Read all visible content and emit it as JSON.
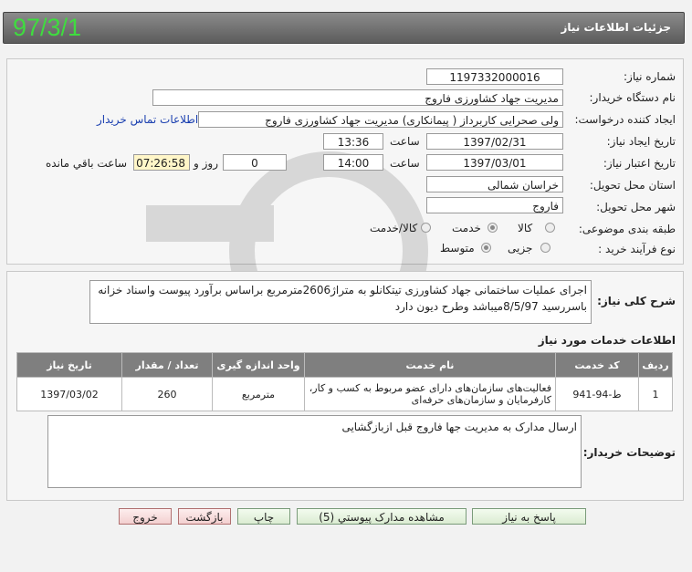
{
  "header": {
    "title": "جزئیات اطلاعات نیاز",
    "date_badge": "97/3/1"
  },
  "form": {
    "need_number": {
      "label": "شماره نیاز:",
      "value": "1197332000016"
    },
    "buyer_org": {
      "label": "نام دستگاه خریدار:",
      "value": "مدیریت جهاد کشاورزی فاروج"
    },
    "requester": {
      "label": "ایجاد کننده درخواست:",
      "value": "ولی صحرایی کاربرداز ( پیمانکاری) مدیریت جهاد کشاورزی فاروج",
      "contact_link": "اطلاعات تماس خریدار"
    },
    "created": {
      "label": "تاریخ ایجاد نیاز:",
      "date": "1397/02/31",
      "time_label": "ساعت",
      "time": "13:36"
    },
    "validity": {
      "label": "تاریخ اعتبار نیاز:",
      "date": "1397/03/01",
      "time_label": "ساعت",
      "time": "14:00",
      "days": "0",
      "days_label": "روز و",
      "remaining": "07:26:58",
      "remaining_label": "ساعت باقي مانده"
    },
    "province": {
      "label": "استان محل تحویل:",
      "value": "خراسان شمالی"
    },
    "city": {
      "label": "شهر محل تحویل:",
      "value": "فاروج"
    },
    "category": {
      "label": "طبقه بندی موضوعی:",
      "options": [
        "کالا",
        "خدمت",
        "کالا/خدمت"
      ],
      "selected": "خدمت"
    },
    "purchase_type": {
      "label": "نوع فرآیند خرید :",
      "options": [
        "جزیی",
        "متوسط"
      ],
      "selected": "متوسط"
    }
  },
  "summary": {
    "label": "شرح کلی نیاز:",
    "text": "اجرای عملیات ساختمانی جهاد کشاورزی تیتکانلو به متراژ2606مترمربع براساس برآورد پیوست واسناد خزانه باسررسید 8/5/97میباشد وطرح دیون دارد"
  },
  "services": {
    "title": "اطلاعات خدمات مورد نیاز",
    "columns": [
      "ردیف",
      "کد خدمت",
      "نام خدمت",
      "واحد اندازه گیری",
      "تعداد / مقدار",
      "تاریخ نیاز"
    ],
    "rows": [
      [
        "1",
        "ط-94-941",
        "فعالیت‌های سازمان‌های دارای عضو مربوط به کسب و کار، کارفرمایان و سازمان‌های حرفه‌ای",
        "مترمربع",
        "260",
        "1397/03/02"
      ]
    ]
  },
  "buyer_notes": {
    "label": "توضیحات خریدار:",
    "text": "ارسال مدارک به مدیریت جها فاروج قبل ازبازگشایی"
  },
  "buttons": {
    "reply": "پاسخ به نیاز",
    "attachments": "مشاهده مدارک پیوستي (5)",
    "print": "چاپ",
    "back": "بازگشت",
    "exit": "خروج"
  },
  "colors": {
    "header_bg": "#6e6e6e",
    "date_green": "#3fdc3f",
    "table_header": "#7f7f7f",
    "highlight": "#fff6c8"
  }
}
